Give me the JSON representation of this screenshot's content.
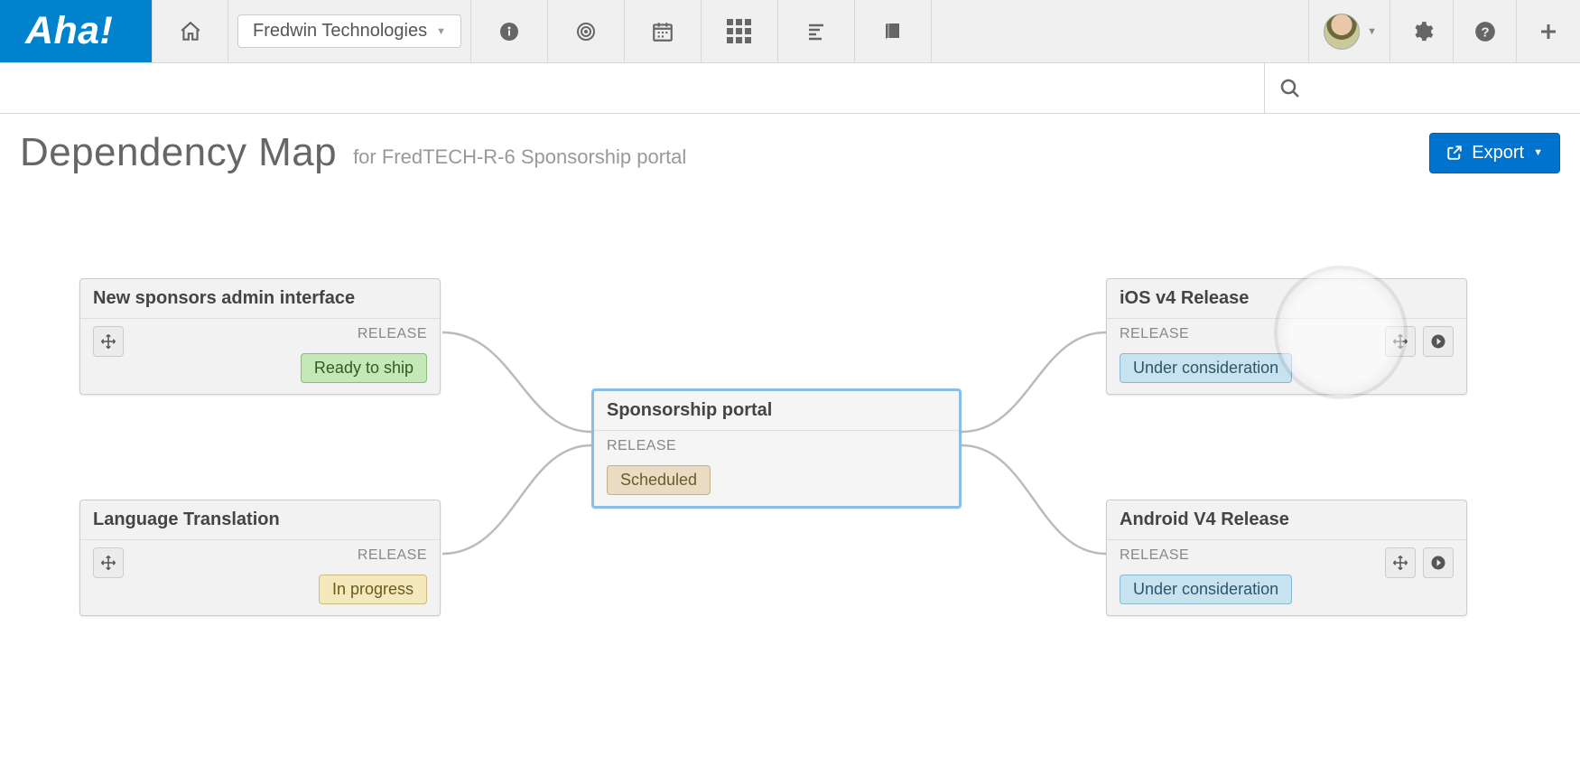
{
  "topbar": {
    "logo": "Aha!",
    "product_name": "Fredwin Technologies"
  },
  "header": {
    "title": "Dependency Map",
    "subtitle": "for FredTECH-R-6 Sponsorship portal",
    "export_label": "Export"
  },
  "center_node": {
    "title": "Sponsorship portal",
    "type": "RELEASE",
    "status": "Scheduled",
    "status_class": "pill-tan"
  },
  "left_nodes": [
    {
      "title": "New sponsors admin interface",
      "type": "RELEASE",
      "status": "Ready to ship",
      "status_class": "pill-green"
    },
    {
      "title": "Language Translation",
      "type": "RELEASE",
      "status": "In progress",
      "status_class": "pill-yellow"
    }
  ],
  "right_nodes": [
    {
      "title": "iOS v4 Release",
      "type": "RELEASE",
      "status": "Under consideration",
      "status_class": "pill-blue"
    },
    {
      "title": "Android V4 Release",
      "type": "RELEASE",
      "status": "Under consideration",
      "status_class": "pill-blue"
    }
  ]
}
